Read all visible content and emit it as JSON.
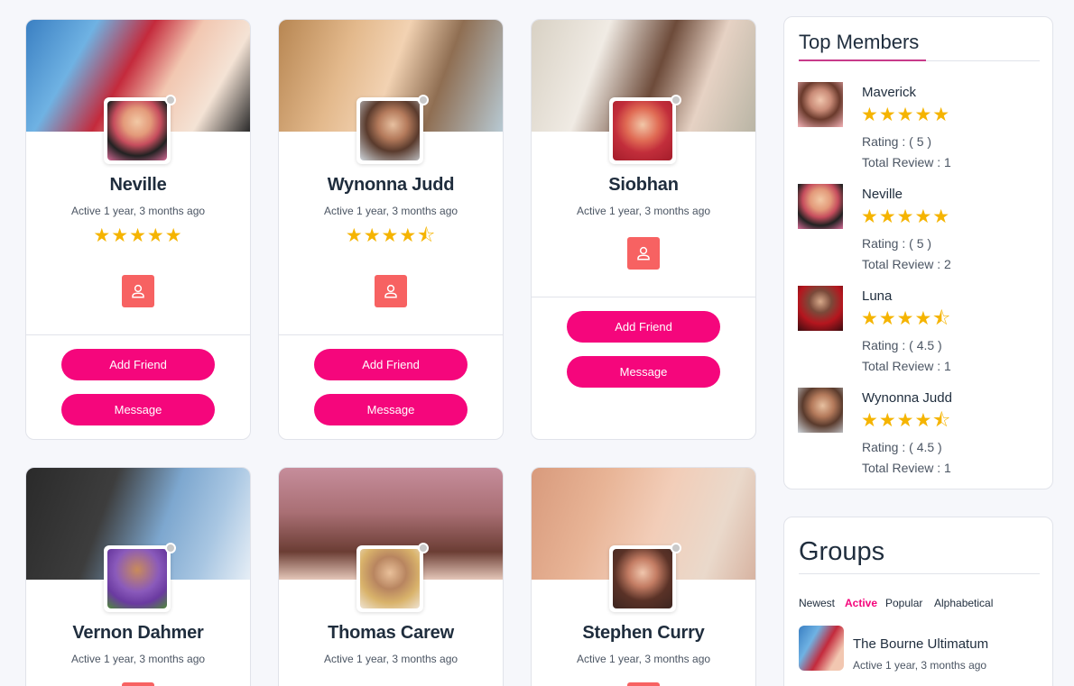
{
  "members": [
    {
      "name": "Neville",
      "active": "Active 1 year, 3 months ago",
      "stars": "★★★★★",
      "add_friend": "Add Friend",
      "message": "Message"
    },
    {
      "name": "Wynonna Judd",
      "active": "Active 1 year, 3 months ago",
      "stars": "★★★★⯪",
      "add_friend": "Add Friend",
      "message": "Message"
    },
    {
      "name": "Siobhan",
      "active": "Active 1 year, 3 months ago",
      "stars": "",
      "add_friend": "Add Friend",
      "message": "Message"
    },
    {
      "name": "Vernon Dahmer",
      "active": "Active 1 year, 3 months ago"
    },
    {
      "name": "Thomas Carew",
      "active": "Active 1 year, 3 months ago"
    },
    {
      "name": "Stephen Curry",
      "active": "Active 1 year, 3 months ago"
    }
  ],
  "top_members": {
    "title": "Top Members",
    "items": [
      {
        "name": "Maverick",
        "stars": "★★★★★",
        "rating": "Rating : ( 5 )",
        "review": "Total Review : 1"
      },
      {
        "name": "Neville",
        "stars": "★★★★★",
        "rating": "Rating : ( 5 )",
        "review": "Total Review : 2"
      },
      {
        "name": "Luna",
        "stars": "★★★★⯪",
        "rating": "Rating : ( 4.5 )",
        "review": "Total Review : 1"
      },
      {
        "name": "Wynonna Judd",
        "stars": "★★★★⯪",
        "rating": "Rating : ( 4.5 )",
        "review": "Total Review : 1"
      }
    ]
  },
  "groups": {
    "title": "Groups",
    "tabs": [
      "Newest",
      "Active",
      "Popular",
      "Alphabetical"
    ],
    "active_tab": "Active",
    "items": [
      {
        "name": "The Bourne Ultimatum",
        "active": "Active 1 year, 3 months ago"
      }
    ]
  },
  "colors": {
    "accent": "#f5067c",
    "profile_button": "#f76262",
    "star": "#f5b400",
    "text": "#1f2d3d"
  }
}
